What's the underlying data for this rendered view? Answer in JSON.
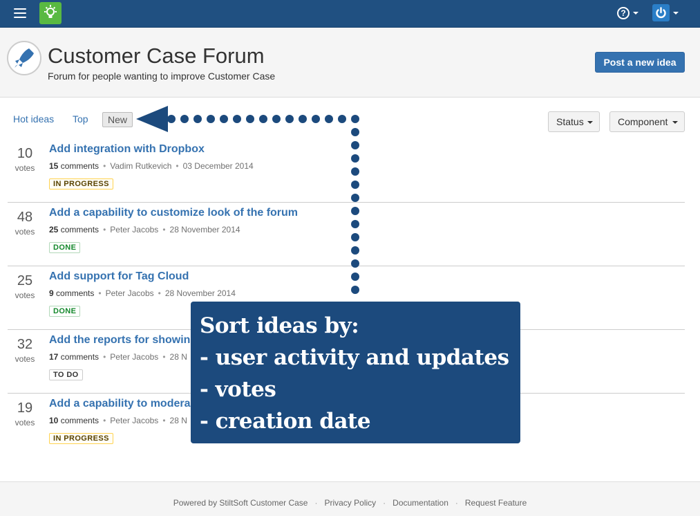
{
  "topbar": {
    "menu_icon": "hamburger-icon",
    "app_icon": "lightbulb-icon",
    "help_icon": "question-circle-icon",
    "help_glyph": "?",
    "user_icon": "power-icon",
    "user_glyph": "⏻",
    "bar_color": "#205081",
    "app_icon_color": "#59b942"
  },
  "header": {
    "forum_icon": "rocket-icon",
    "title": "Customer Case Forum",
    "subtitle": "Forum for people wanting to improve Customer Case",
    "post_button": "Post a new idea"
  },
  "sort_tabs": [
    {
      "label": "Hot ideas",
      "active": false
    },
    {
      "label": "Top",
      "active": false
    },
    {
      "label": "New",
      "active": true
    }
  ],
  "filters": {
    "status_label": "Status",
    "component_label": "Component"
  },
  "ideas": [
    {
      "votes": "10",
      "votes_label": "votes",
      "title": "Add integration with Dropbox",
      "comments_count": "15",
      "comments_label": "comments",
      "author": "Vadim Rutkevich",
      "date": "03 December 2014",
      "status": "IN PROGRESS"
    },
    {
      "votes": "48",
      "votes_label": "votes",
      "title": "Add a capability to customize look of the forum",
      "comments_count": "25",
      "comments_label": "comments",
      "author": "Peter Jacobs",
      "date": "28 November 2014",
      "status": "DONE"
    },
    {
      "votes": "25",
      "votes_label": "votes",
      "title": "Add support for Tag Cloud",
      "comments_count": "9",
      "comments_label": "comments",
      "author": "Peter Jacobs",
      "date": "28 November 2014",
      "status": "DONE"
    },
    {
      "votes": "32",
      "votes_label": "votes",
      "title": "Add the reports for showin",
      "comments_count": "17",
      "comments_label": "comments",
      "author": "Peter Jacobs",
      "date": "28 N",
      "status": "TO DO"
    },
    {
      "votes": "19",
      "votes_label": "votes",
      "title": "Add a capability to modera",
      "comments_count": "10",
      "comments_label": "comments",
      "author": "Peter Jacobs",
      "date": "28 N",
      "status": "IN PROGRESS"
    }
  ],
  "status_colors": {
    "IN PROGRESS": {
      "fg": "#594300",
      "bg": "#fffdf6",
      "border": "#ffd351"
    },
    "DONE": {
      "fg": "#14892c",
      "bg": "#ffffff",
      "border": "#b2d8b9"
    },
    "TO DO": {
      "fg": "#333333",
      "bg": "#ffffff",
      "border": "#cccccc"
    }
  },
  "callout": {
    "lines": [
      "Sort ideas by:",
      "- user activity and updates",
      "- votes",
      "- creation date"
    ],
    "color": "#1c4a7d"
  },
  "footer": {
    "powered_by": "Powered by StiltSoft Customer Case",
    "separator": "·",
    "links": [
      "Privacy Policy",
      "Documentation",
      "Request Feature"
    ]
  }
}
